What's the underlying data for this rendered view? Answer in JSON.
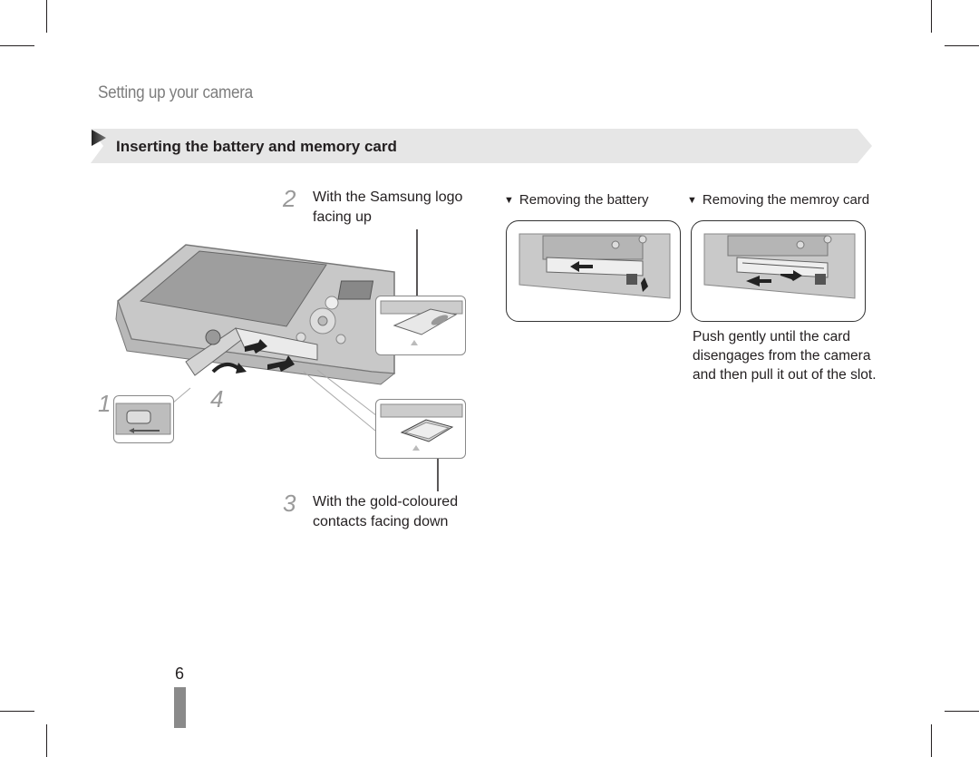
{
  "page": {
    "section_title": "Setting up your camera",
    "banner_title": "Inserting the battery and memory card",
    "page_number": "6"
  },
  "steps": [
    {
      "number": "1",
      "caption": ""
    },
    {
      "number": "2",
      "caption_line1": "With the Samsung logo",
      "caption_line2": "facing up"
    },
    {
      "number": "3",
      "caption_line1": "With the gold-coloured",
      "caption_line2": "contacts facing down"
    },
    {
      "number": "4",
      "caption": ""
    }
  ],
  "removal": {
    "battery_heading": "Removing the battery",
    "card_heading": "Removing the memroy card",
    "card_note_line1": "Push gently until the card",
    "card_note_line2": "disengages from the camera",
    "card_note_line3": "and then pull it out of the slot."
  },
  "icons": {
    "bullet": "▼",
    "banner_arrow": "play-icon"
  },
  "colors": {
    "banner_bg": "#e6e6e6",
    "section_title": "#7d7d7d",
    "step_number": "#9a9a9a",
    "page_tab": "#8a8a8a"
  }
}
